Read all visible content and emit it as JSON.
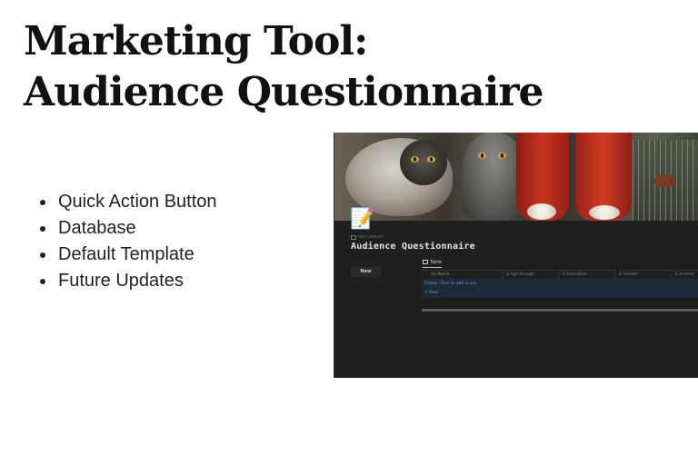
{
  "title": {
    "line1": "Marketing Tool:",
    "line2": "Audience Questionnaire"
  },
  "bullets": [
    "Quick Action Button",
    "Database",
    "Default Template",
    "Future Updates"
  ],
  "app": {
    "page_icon": "memo-icon",
    "page_icon_glyph": "📝",
    "add_comment": "Add comment",
    "page_title": "Audience Questionnaire",
    "new_button": "New",
    "view_tab": "Table",
    "columns": [
      "Aa Name",
      "☰ Age Groups",
      "☰ Education",
      "☰ Gender",
      "☰ Income"
    ],
    "empty_row": "Empty. Click to add a row.",
    "add_row": "+ New"
  }
}
